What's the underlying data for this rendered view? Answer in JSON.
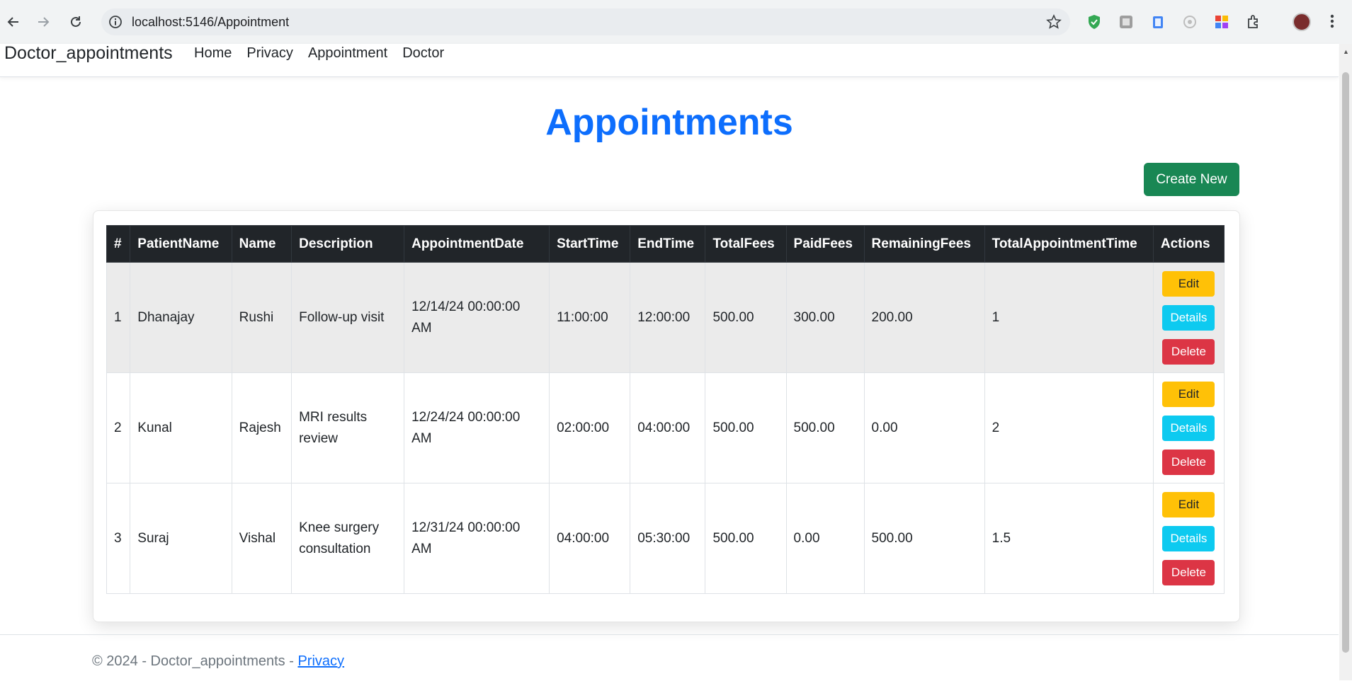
{
  "browser": {
    "url": "localhost:5146/Appointment"
  },
  "navbar": {
    "brand": "Doctor_appointments",
    "links": [
      "Home",
      "Privacy",
      "Appointment",
      "Doctor"
    ]
  },
  "page": {
    "title": "Appointments",
    "create_label": "Create New"
  },
  "table": {
    "headers": [
      "#",
      "PatientName",
      "Name",
      "Description",
      "AppointmentDate",
      "StartTime",
      "EndTime",
      "TotalFees",
      "PaidFees",
      "RemainingFees",
      "TotalAppointmentTime",
      "Actions"
    ],
    "rows": [
      {
        "num": "1",
        "patient": "Dhanajay",
        "name": "Rushi",
        "description": "Follow-up visit",
        "date": "12/14/24 00:00:00 AM",
        "start": "11:00:00",
        "end": "12:00:00",
        "total": "500.00",
        "paid": "300.00",
        "remaining": "200.00",
        "time": "1"
      },
      {
        "num": "2",
        "patient": "Kunal",
        "name": "Rajesh",
        "description": "MRI results review",
        "date": "12/24/24 00:00:00 AM",
        "start": "02:00:00",
        "end": "04:00:00",
        "total": "500.00",
        "paid": "500.00",
        "remaining": "0.00",
        "time": "2"
      },
      {
        "num": "3",
        "patient": "Suraj",
        "name": "Vishal",
        "description": "Knee surgery consultation",
        "date": "12/31/24 00:00:00 AM",
        "start": "04:00:00",
        "end": "05:30:00",
        "total": "500.00",
        "paid": "0.00",
        "remaining": "500.00",
        "time": "1.5"
      }
    ],
    "actions": {
      "edit": "Edit",
      "details": "Details",
      "delete": "Delete"
    }
  },
  "footer": {
    "text": "© 2024 - Doctor_appointments - ",
    "link": "Privacy"
  },
  "colors": {
    "title": "#0d6efd",
    "create": "#198754",
    "edit": "#ffc107",
    "details": "#0dcaf0",
    "delete": "#dc3545",
    "header": "#212529"
  },
  "icons": [
    "back-arrow-icon",
    "forward-arrow-icon",
    "reload-icon",
    "site-info-icon",
    "bookmark-star-icon",
    "shield-extension-icon",
    "image-extension-icon",
    "clipboard-extension-icon",
    "circle-extension-icon",
    "puzzle-color-extension-icon",
    "extensions-puzzle-icon",
    "profile-avatar",
    "menu-kebab-icon"
  ]
}
